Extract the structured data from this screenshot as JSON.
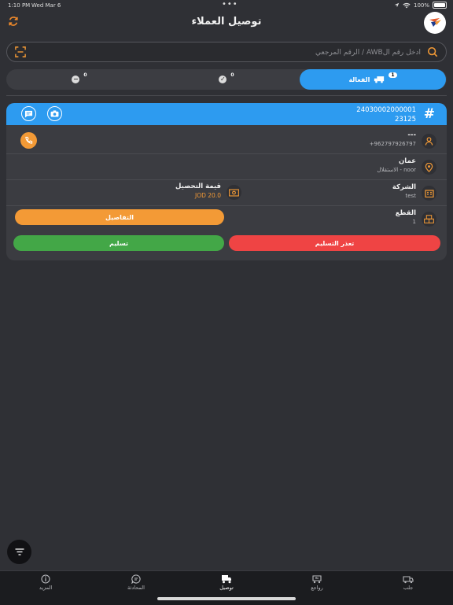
{
  "status_bar": {
    "time": "1:10 PM",
    "date": "Wed Mar 6",
    "battery": "100%"
  },
  "header": {
    "title": "توصيل العملاء"
  },
  "search": {
    "placeholder": "ادخل رقم الAWB / الرقم المرجعي",
    "value": ""
  },
  "tabs": [
    {
      "label": "الفعالة",
      "count": "1",
      "active": true,
      "icon": "truck-icon"
    },
    {
      "label": "",
      "count": "0",
      "active": false,
      "icon": "check-circle-icon"
    },
    {
      "label": "",
      "count": "0",
      "active": false,
      "icon": "minus-circle-icon"
    }
  ],
  "shipment": {
    "awb": "24030002000001",
    "reference": "23125",
    "customer_name": "---",
    "phone": "+962797926797",
    "city": "عمان",
    "area": "الاستقلال - noor",
    "company_label": "الشركة",
    "company_value": "test",
    "collection_label": "قيمة التحصيل",
    "collection_value": "JOD 20.0",
    "pieces_label": "القطع",
    "pieces_value": "1",
    "details_button": "التفاصيل",
    "fail_button": "تعذر التسليم",
    "deliver_button": "تسليم"
  },
  "colors": {
    "accent_blue": "#2d9bf0",
    "orange": "#f39a36",
    "red": "#ef4444",
    "green": "#43a747"
  },
  "tabbar": [
    {
      "label": "جلب",
      "icon": "pickup-truck-icon",
      "active": false
    },
    {
      "label": "رواجع",
      "icon": "return-truck-icon",
      "active": false
    },
    {
      "label": "توصيل",
      "icon": "delivery-truck-icon",
      "active": true
    },
    {
      "label": "المحادثة",
      "icon": "chat-icon",
      "active": false
    },
    {
      "label": "المزيد",
      "icon": "info-icon",
      "active": false
    }
  ]
}
